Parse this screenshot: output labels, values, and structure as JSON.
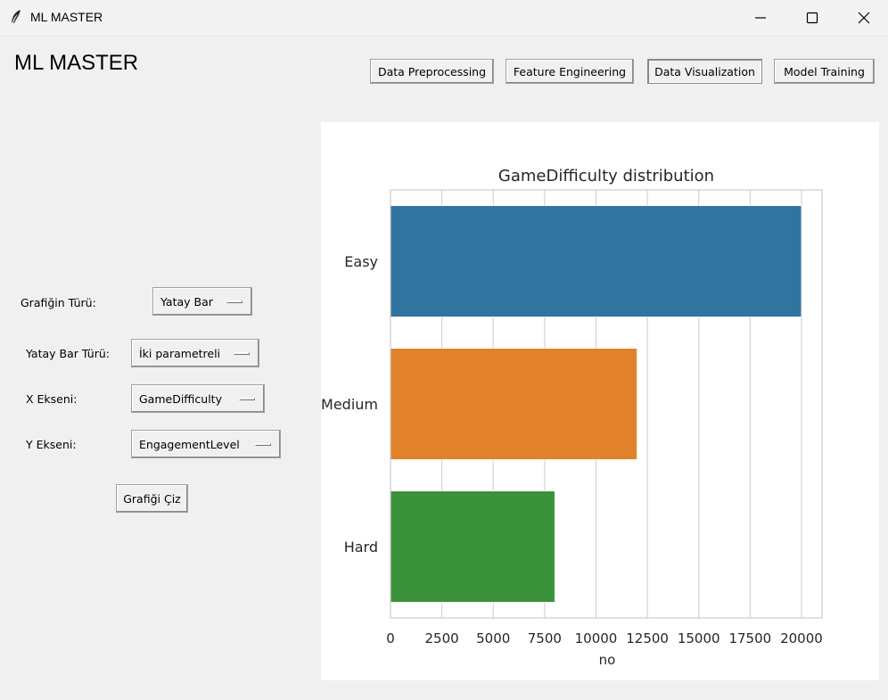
{
  "window": {
    "title": "ML MASTER"
  },
  "header": {
    "title": "ML MASTER"
  },
  "nav": {
    "tabs": [
      {
        "label": "Data Preprocessing"
      },
      {
        "label": "Feature Engineering"
      },
      {
        "label": "Data Visualization"
      },
      {
        "label": "Model Training"
      }
    ]
  },
  "controls": {
    "chart_type": {
      "label": "Grafiğin Türü:",
      "value": "Yatay Bar"
    },
    "bar_type": {
      "label": "Yatay Bar Türü:",
      "value": "İki parametreli"
    },
    "x_axis": {
      "label": "X Ekseni:",
      "value": "GameDifficulty"
    },
    "y_axis": {
      "label": "Y Ekseni:",
      "value": "EngagementLevel"
    },
    "draw_button": "Grafiği Çiz"
  },
  "chart_data": {
    "type": "bar",
    "orientation": "horizontal",
    "title": "GameDifficulty distribution",
    "xlabel": "no",
    "ylabel": "",
    "categories": [
      "Easy",
      "Medium",
      "Hard"
    ],
    "values": [
      20000,
      12000,
      8000
    ],
    "colors": [
      "#3274a1",
      "#e1812c",
      "#3a923a"
    ],
    "xlim": [
      0,
      21000
    ],
    "xticks": [
      0,
      2500,
      5000,
      7500,
      10000,
      12500,
      15000,
      17500,
      20000
    ],
    "grid": "vertical"
  }
}
